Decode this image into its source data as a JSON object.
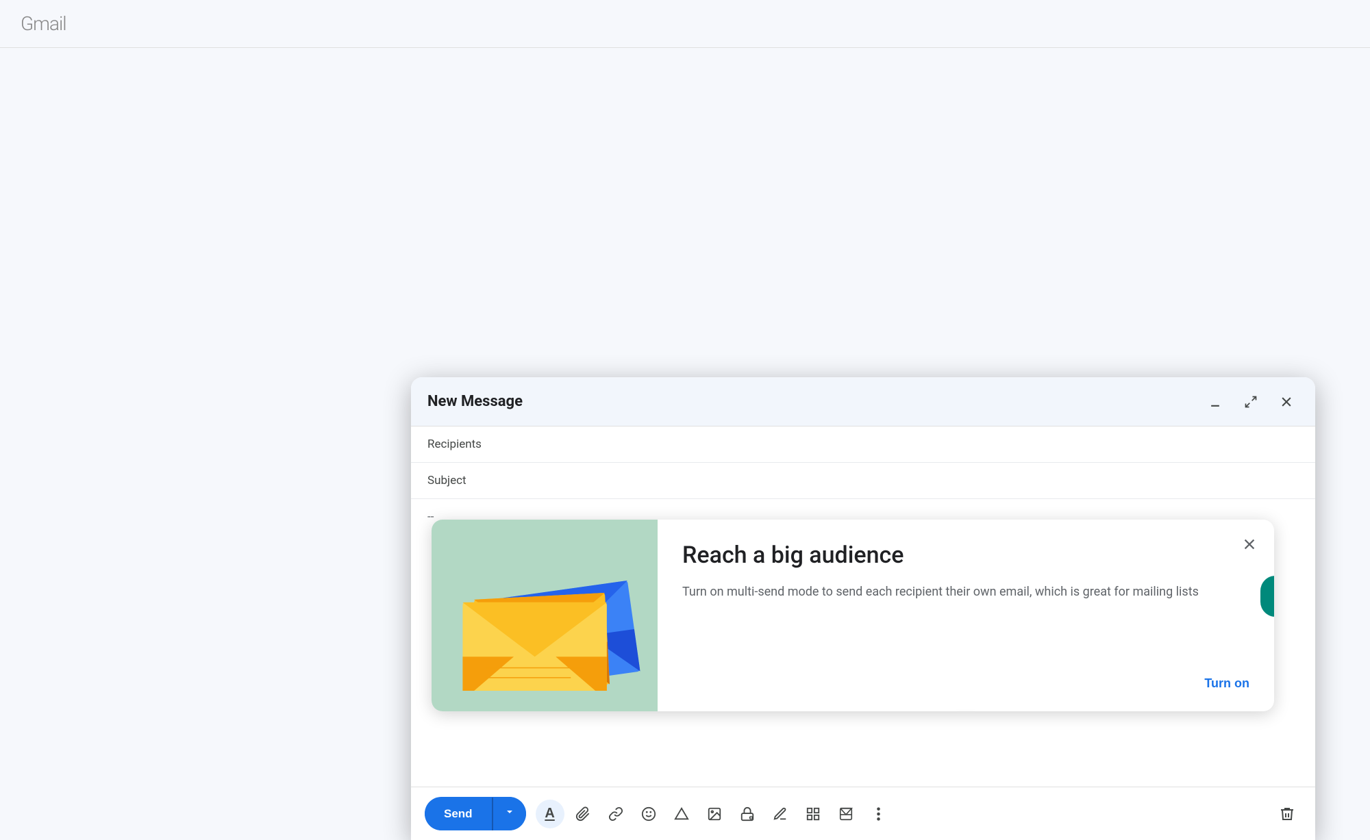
{
  "compose": {
    "title": "New Message",
    "recipients_placeholder": "Recipients",
    "subject_placeholder": "Subject",
    "body_text": "--",
    "minimize_label": "Minimize",
    "expand_label": "Full screen",
    "close_label": "Close"
  },
  "promo": {
    "title": "Reach a big audience",
    "description": "Turn on multi-send mode to send each recipient their own email, which is great for mailing lists",
    "turn_on_label": "Turn on",
    "close_label": "×"
  },
  "toolbar": {
    "send_label": "Send",
    "send_dropdown_label": "▼",
    "formatting_label": "A",
    "attachment_label": "📎",
    "link_label": "🔗",
    "emoji_label": "😊",
    "drive_label": "△",
    "photo_label": "🖼",
    "lock_label": "🔒",
    "signature_label": "✏",
    "more_options_label": "⋮",
    "delete_label": "🗑"
  }
}
